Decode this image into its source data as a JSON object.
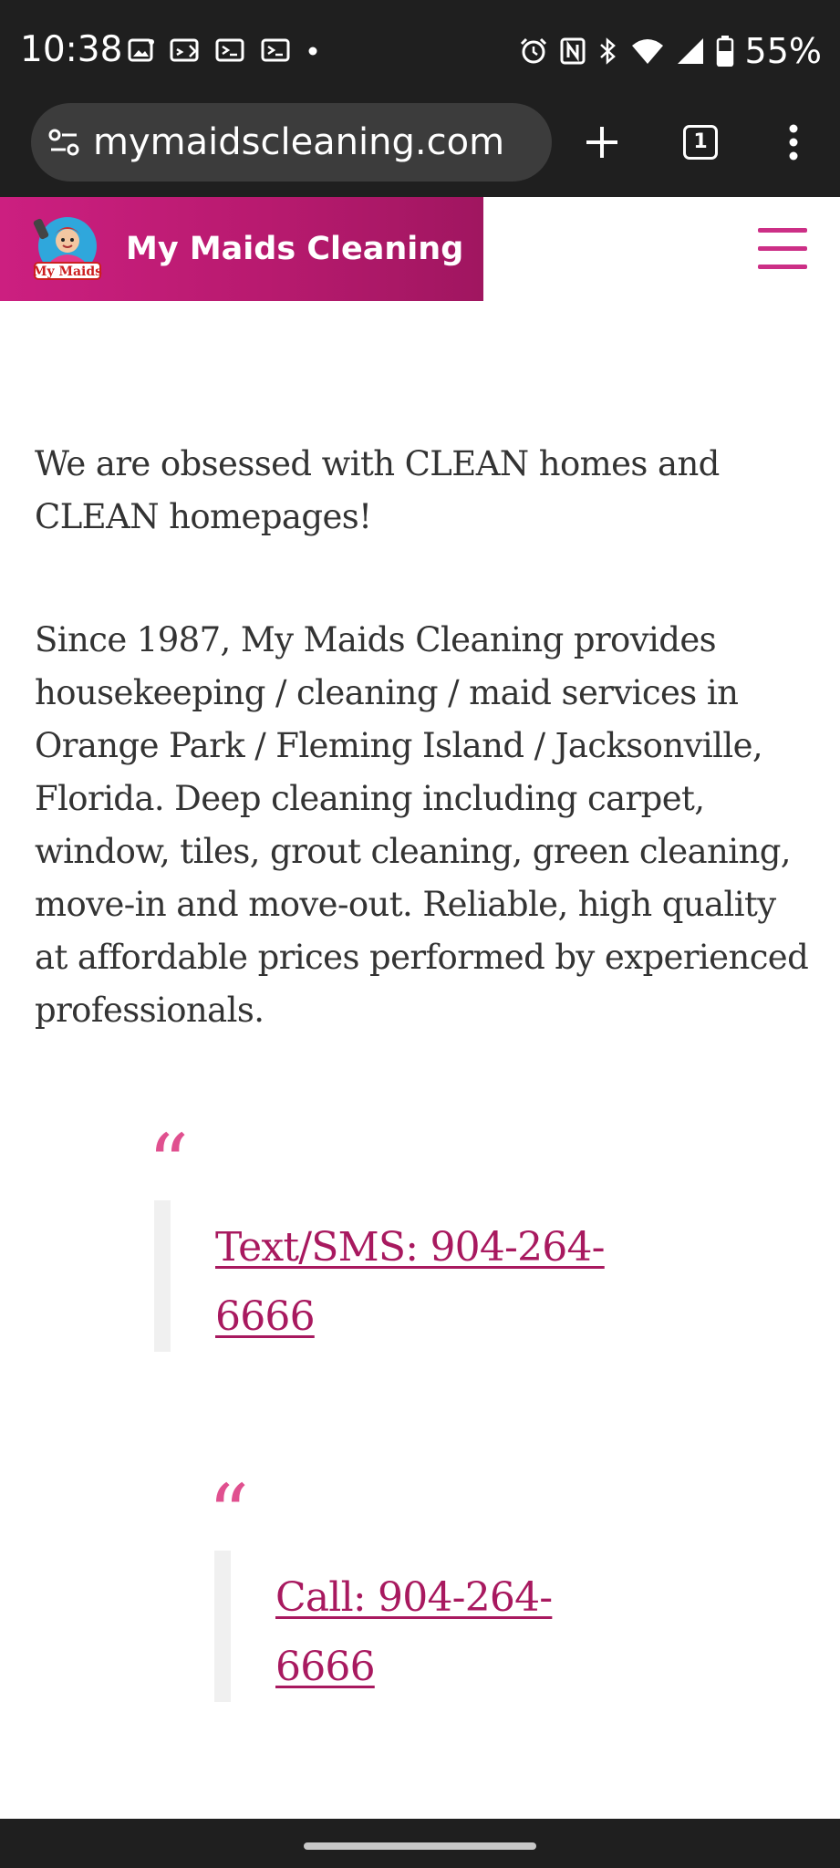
{
  "status_bar": {
    "time": "10:38",
    "battery": "55%",
    "notification_icons": [
      "image-icon",
      "screen-share-icon",
      "terminal-icon",
      "terminal-icon",
      "dot-icon"
    ],
    "system_icons": [
      "alarm-icon",
      "nfc-icon",
      "bluetooth-icon",
      "wifi-icon",
      "signal-icon",
      "battery-icon"
    ]
  },
  "browser": {
    "url": "mymaidscleaning.com",
    "tab_count": "1",
    "icons": [
      "site-info-icon",
      "new-tab-icon",
      "tab-switcher-icon",
      "more-menu-icon"
    ]
  },
  "site": {
    "brand_name": "My Maids Cleaning",
    "logo_text": "My Maids",
    "brand_color": "#c21d78",
    "link_color": "#a8195f"
  },
  "content": {
    "intro": "We are obsessed with CLEAN homes and CLEAN homepages!",
    "description": "Since 1987, My Maids Cleaning provides housekeeping / cleaning / maid services in Orange Park / Fleming Island / Jacksonville, Florida. Deep cleaning including carpet, window, tiles, grout cleaning, green cleaning, move-in and move-out. Reliable, high quality at affordable prices performed by experienced professionals.",
    "quotes": [
      {
        "mark": "“",
        "link": "Text/SMS: 904-264-6666"
      },
      {
        "mark": "“",
        "link": "Call: 904-264-6666"
      }
    ]
  }
}
